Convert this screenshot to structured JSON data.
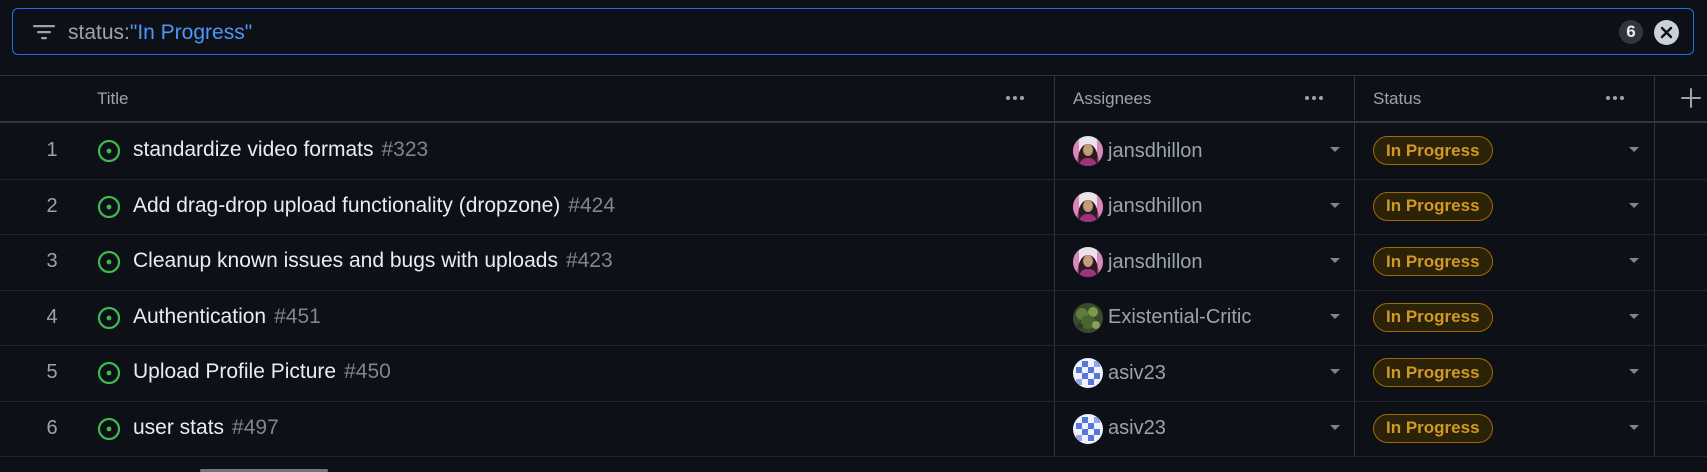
{
  "filter": {
    "key": "status:",
    "value": "\"In Progress\"",
    "count": "6"
  },
  "columns": {
    "title": "Title",
    "assignees": "Assignees",
    "status": "Status"
  },
  "rows": [
    {
      "num": "1",
      "title": "standardize video formats",
      "issue": "#323",
      "assignee": "jansdhillon",
      "avatar": "portrait",
      "status": "In Progress"
    },
    {
      "num": "2",
      "title": "Add drag-drop upload functionality (dropzone)",
      "issue": "#424",
      "assignee": "jansdhillon",
      "avatar": "portrait",
      "status": "In Progress"
    },
    {
      "num": "3",
      "title": "Cleanup known issues and bugs with uploads",
      "issue": "#423",
      "assignee": "jansdhillon",
      "avatar": "portrait",
      "status": "In Progress"
    },
    {
      "num": "4",
      "title": "Authentication",
      "issue": "#451",
      "assignee": "Existential-Critic",
      "avatar": "green",
      "status": "In Progress"
    },
    {
      "num": "5",
      "title": "Upload Profile Picture",
      "issue": "#450",
      "assignee": "asiv23",
      "avatar": "checker",
      "status": "In Progress"
    },
    {
      "num": "6",
      "title": "user stats",
      "issue": "#497",
      "assignee": "asiv23",
      "avatar": "checker",
      "status": "In Progress"
    }
  ],
  "colors": {
    "accent": "#1f6feb",
    "open_issue": "#3fb950",
    "status_in_progress": "#d29922"
  },
  "icons": {
    "filter": "filter-icon",
    "clear": "close-icon",
    "open_issue": "issue-opened-icon",
    "column_menu": "kebab-horizontal-icon",
    "add_field": "plus-icon",
    "dropdown": "triangle-down-icon"
  }
}
